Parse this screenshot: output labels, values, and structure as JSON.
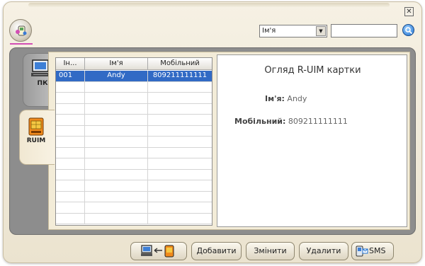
{
  "window": {
    "close_symbol": "✕",
    "menu_icon": "menu-orb-icon"
  },
  "search": {
    "field_selected": "Ім'я",
    "input_value": "",
    "button_icon": "magnifier-icon"
  },
  "tabs": [
    {
      "label": "ПК",
      "icon": "computer-icon",
      "active": false
    },
    {
      "label": "RUIM",
      "icon": "sim-card-icon",
      "active": true
    }
  ],
  "table": {
    "columns": [
      "Ін...",
      "Ім'я",
      "Мобільний"
    ],
    "rows": [
      {
        "index": "001",
        "name": "Andy",
        "mobile": "809211111111"
      }
    ],
    "selected_row": 0
  },
  "detail": {
    "title": "Огляд R-UIM картки",
    "name_label": "Ім'я:",
    "name_value": "Andy",
    "mobile_label": "Мобільний:",
    "mobile_value": "809211111111"
  },
  "footer": {
    "transfer_icon": "pc-to-phone-transfer-icon",
    "add_label": "Добавити",
    "edit_label": "Змінити",
    "delete_label": "Удалити",
    "sms_label": "SMS",
    "sms_icon": "sms-phone-icon"
  },
  "colors": {
    "selection": "#316ac5",
    "accent_underline": "#d24fb4",
    "panel_gray": "#8d8d8d",
    "frame_beige": "#f3ecd8"
  }
}
